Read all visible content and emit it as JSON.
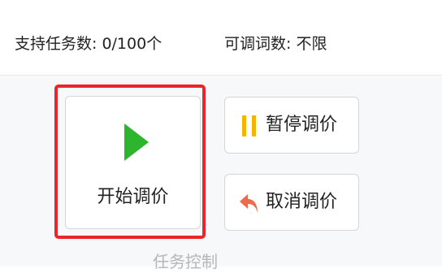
{
  "info": {
    "supported_tasks": "支持任务数: 0/100个",
    "adjust_words": "可调词数: 不限"
  },
  "buttons": {
    "start_label": "开始调价",
    "pause_label": "暂停调价",
    "cancel_label": "取消调价"
  },
  "section": {
    "title": "任务控制"
  },
  "icons": {
    "start": "play-icon",
    "pause": "pause-icon",
    "cancel": "undo-arrow-icon"
  },
  "colors": {
    "play": "#2db52d",
    "pause": "#f5b400",
    "cancel": "#ee6a4c",
    "highlight": "#e8262b"
  }
}
